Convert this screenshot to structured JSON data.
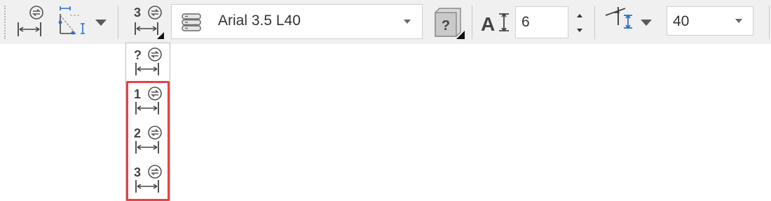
{
  "toolbar": {
    "current_style_number": "3",
    "font_style_value": "Arial 3.5 L40",
    "text_height_value": "6",
    "angle_value": "40"
  },
  "dimension_menu": {
    "items": [
      {
        "label": "?"
      },
      {
        "label": "1"
      },
      {
        "label": "2"
      },
      {
        "label": "3"
      }
    ]
  },
  "colors": {
    "toolbar_bg": "#f0f0f0",
    "highlight": "#e84245",
    "accent_blue": "#2a6fc9"
  }
}
